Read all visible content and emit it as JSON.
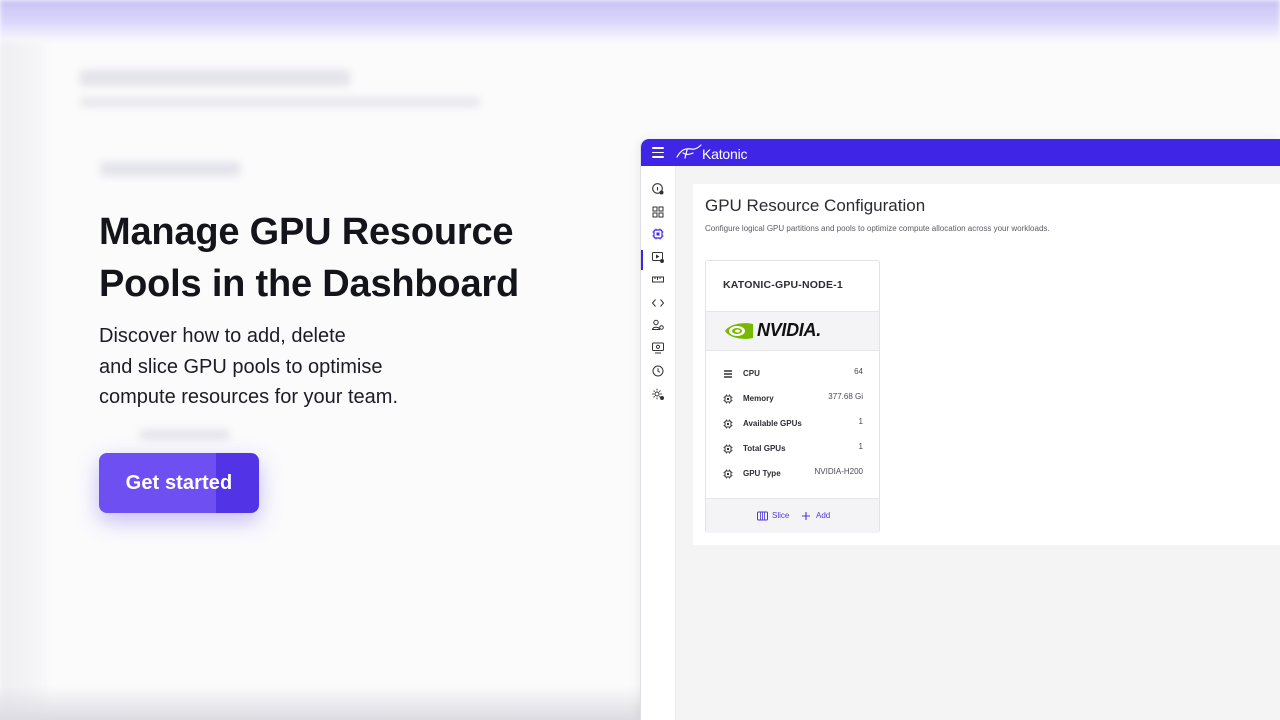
{
  "hero": {
    "title_line1": "Manage GPU Resource",
    "title_line2": "Pools in the Dashboard",
    "desc_line1": "Discover how to add, delete",
    "desc_line2": "and slice GPU pools to optimise",
    "desc_line3": "compute resources for your team.",
    "cta_label": "Get started"
  },
  "dashboard": {
    "brand": "Katonic",
    "page_title": "GPU Resource Configuration",
    "page_subtitle": "Configure logical GPU partitions and pools to optimize compute allocation across your workloads.",
    "sidebar_icons": [
      "info-icon",
      "grid-icon",
      "cpu-chip-icon",
      "video-icon",
      "ruler-icon",
      "code-icon",
      "users-icon",
      "monitor-icon",
      "history-icon",
      "gear-icon"
    ],
    "node": {
      "name": "KATONIC-GPU-NODE-1",
      "vendor": "NVIDIA.",
      "specs": [
        {
          "label": "CPU",
          "value": "64",
          "icon": "list-icon"
        },
        {
          "label": "Memory",
          "value": "377.68 Gi",
          "icon": "chip-icon"
        },
        {
          "label": "Available GPUs",
          "value": "1",
          "icon": "chip-icon"
        },
        {
          "label": "Total GPUs",
          "value": "1",
          "icon": "chip-icon"
        },
        {
          "label": "GPU Type",
          "value": "NVIDIA-H200",
          "icon": "chip-icon"
        }
      ],
      "actions": {
        "slice_label": "Slice",
        "add_label": "Add"
      }
    }
  },
  "colors": {
    "accent": "#6e50f2",
    "accent_dark": "#5234e6",
    "topbar": "#3f25e5",
    "nvidia_green": "#76b900"
  }
}
